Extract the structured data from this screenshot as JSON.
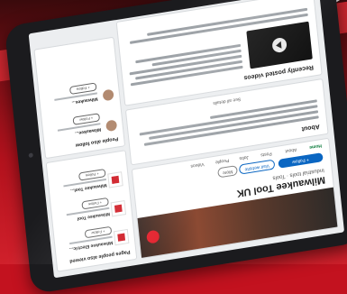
{
  "company": {
    "name": "Milwaukee Tool UK",
    "tagline": "Industrial tools · Tools"
  },
  "buttons": {
    "follow": "+ Follow",
    "visit": "Visit website",
    "more": "More"
  },
  "tabs": [
    "Home",
    "About",
    "Posts",
    "Jobs",
    "People",
    "Videos"
  ],
  "about": {
    "title": "About",
    "see_all": "See all details"
  },
  "updates": {
    "title": "Recently posted videos"
  },
  "sidebar": {
    "pages_title": "Pages people also viewed",
    "people_title": "People also follow",
    "follow_label": "+ Follow",
    "pages": [
      {
        "name": "Milwaukee Electric..."
      },
      {
        "name": "Milwaukee Tool"
      },
      {
        "name": "Milwaukee Tool..."
      }
    ],
    "people": [
      {
        "name": "Milwaukee..."
      },
      {
        "name": "Milwaukee..."
      }
    ]
  },
  "colors": {
    "background": "#c3121f",
    "accent": "#0a66c2",
    "brand": "#d01f28"
  }
}
